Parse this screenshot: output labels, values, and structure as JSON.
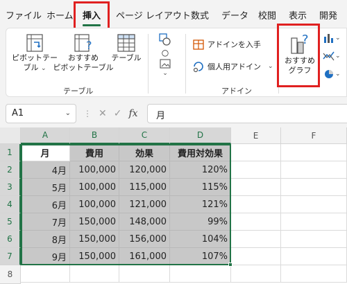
{
  "tabs": [
    {
      "label": "ファイル"
    },
    {
      "label": "ホーム"
    },
    {
      "label": "挿入"
    },
    {
      "label": "ページ レイアウト"
    },
    {
      "label": "数式"
    },
    {
      "label": "データ"
    },
    {
      "label": "校閲"
    },
    {
      "label": "表示"
    },
    {
      "label": "開発"
    }
  ],
  "ribbon": {
    "pivot_table": {
      "line1": "ピボットテー",
      "line2": "ブル"
    },
    "recommended_pivot": {
      "line1": "おすすめ",
      "line2": "ピボットテーブル"
    },
    "table": {
      "label": "テーブル"
    },
    "table_group_label": "テーブル",
    "get_addins": {
      "label": "アドインを入手"
    },
    "my_addins": {
      "label": "個人用アドイン"
    },
    "addins_group_label": "アドイン",
    "recommended_charts": {
      "line1": "おすすめ",
      "line2": "グラフ"
    }
  },
  "formula_bar": {
    "name_box": "A1",
    "formula": "月"
  },
  "sheet": {
    "columns": [
      "A",
      "B",
      "C",
      "D",
      "E",
      "F"
    ],
    "rows": [
      "1",
      "2",
      "3",
      "4",
      "5",
      "6",
      "7",
      "8"
    ],
    "headers": [
      "月",
      "費用",
      "効果",
      "費用対効果"
    ],
    "data": [
      [
        "4月",
        "100,000",
        "120,000",
        "120%"
      ],
      [
        "5月",
        "100,000",
        "115,000",
        "115%"
      ],
      [
        "6月",
        "100,000",
        "121,000",
        "121%"
      ],
      [
        "7月",
        "150,000",
        "148,000",
        "99%"
      ],
      [
        "8月",
        "150,000",
        "156,000",
        "104%"
      ],
      [
        "9月",
        "150,000",
        "161,000",
        "107%"
      ]
    ]
  },
  "colors": {
    "accent": "#217346",
    "highlight_box": "#e02020",
    "selection_fill": "#c8c8c8"
  }
}
